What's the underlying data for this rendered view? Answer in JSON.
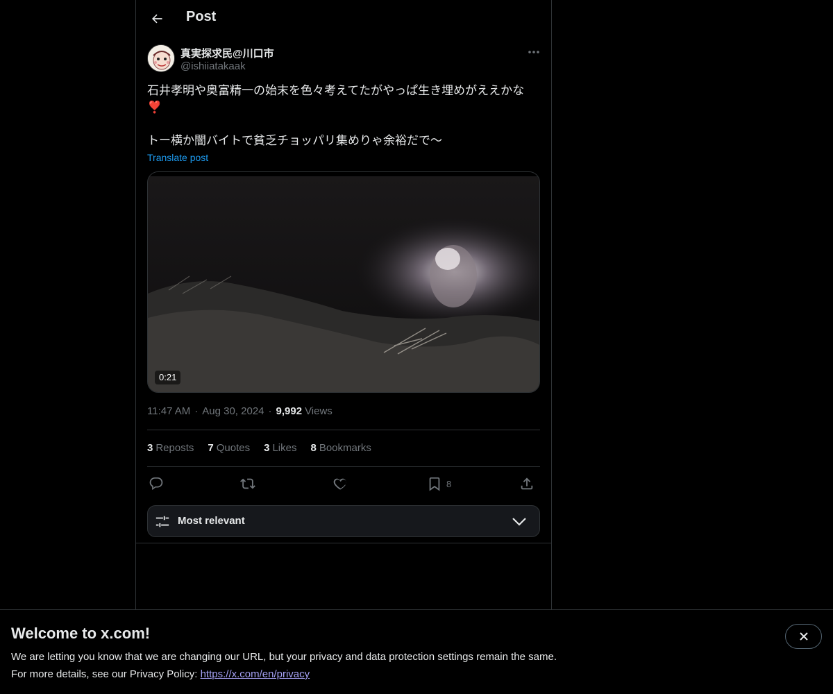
{
  "header": {
    "title": "Post"
  },
  "author": {
    "display_name": "真実探求民@川口市",
    "handle": "@ishiiatakaak"
  },
  "post": {
    "text": "石井孝明や奥富精一の始末を色々考えてたがやっぱ生き埋めがええかな\n❣️\n\nトー横か闇バイトで貧乏チョッパリ集めりゃ余裕だで〜",
    "translate_label": "Translate post",
    "video_duration": "0:21",
    "time": "11:47 AM",
    "separator": "·",
    "date": "Aug 30, 2024",
    "views_count": "9,992",
    "views_label": "Views"
  },
  "stats": [
    {
      "count": "3",
      "label": "Reposts"
    },
    {
      "count": "7",
      "label": "Quotes"
    },
    {
      "count": "3",
      "label": "Likes"
    },
    {
      "count": "8",
      "label": "Bookmarks"
    }
  ],
  "actions": {
    "reply_icon": "reply-icon",
    "repost_icon": "repost-icon",
    "like_icon": "heart-icon",
    "bookmark_icon": "bookmark-icon",
    "bookmark_count": "8",
    "share_icon": "share-icon"
  },
  "sort": {
    "label": "Most relevant"
  },
  "banner": {
    "title": "Welcome to x.com!",
    "line1": "We are letting you know that we are changing our URL, but your privacy and data protection settings remain the same.",
    "line2_prefix": "For more details, see our Privacy Policy: ",
    "link": "https://x.com/en/privacy"
  },
  "colors": {
    "background": "#000000",
    "link": "#1d9bf0",
    "muted": "#71767b",
    "text": "#e7e9ea",
    "privacy_link": "#a5a1f5"
  }
}
